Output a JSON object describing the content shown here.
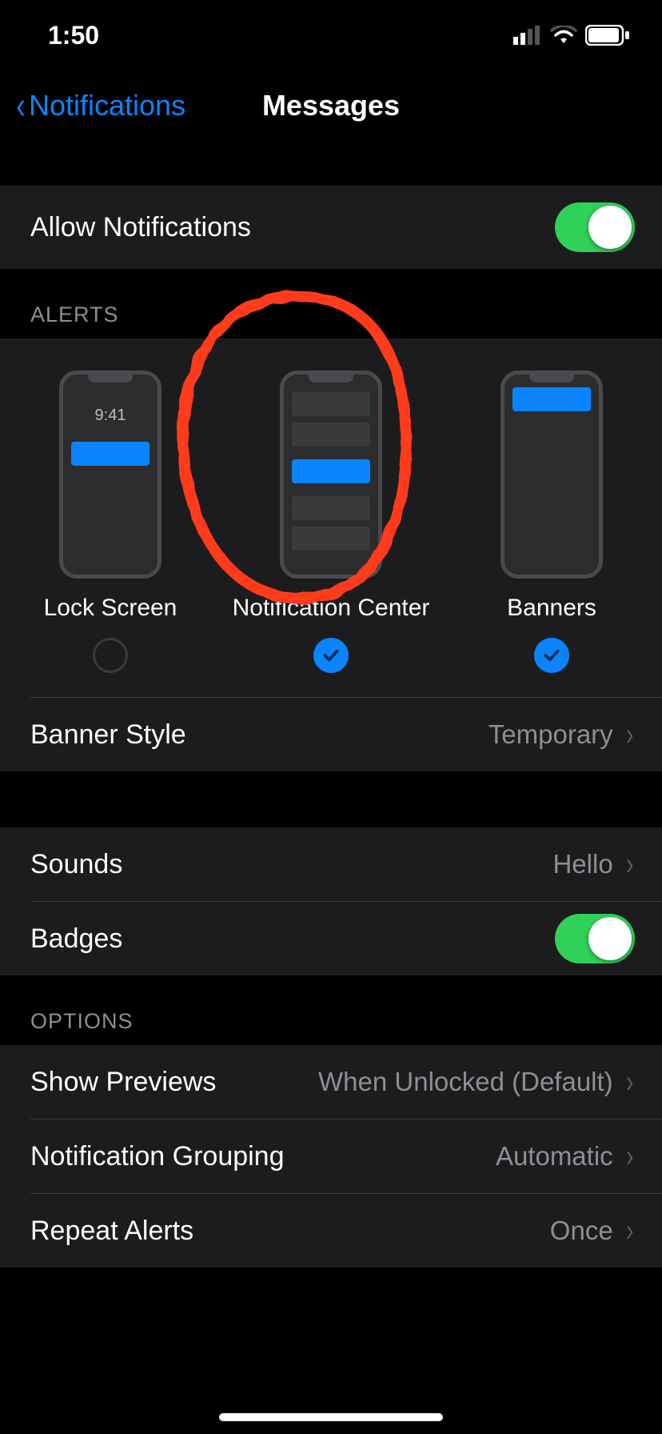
{
  "status": {
    "time": "1:50"
  },
  "nav": {
    "back_label": "Notifications",
    "title": "Messages"
  },
  "allow": {
    "label": "Allow Notifications",
    "on": true
  },
  "alerts": {
    "header": "ALERTS",
    "lock_time": "9:41",
    "options": [
      {
        "label": "Lock Screen",
        "checked": false
      },
      {
        "label": "Notification Center",
        "checked": true
      },
      {
        "label": "Banners",
        "checked": true
      }
    ],
    "banner_style": {
      "label": "Banner Style",
      "value": "Temporary"
    }
  },
  "sounds": {
    "label": "Sounds",
    "value": "Hello"
  },
  "badges": {
    "label": "Badges",
    "on": true
  },
  "options": {
    "header": "OPTIONS",
    "previews": {
      "label": "Show Previews",
      "value": "When Unlocked (Default)"
    },
    "grouping": {
      "label": "Notification Grouping",
      "value": "Automatic"
    },
    "repeat": {
      "label": "Repeat Alerts",
      "value": "Once"
    }
  },
  "annotation": {
    "present": true,
    "target": "notification-center"
  }
}
